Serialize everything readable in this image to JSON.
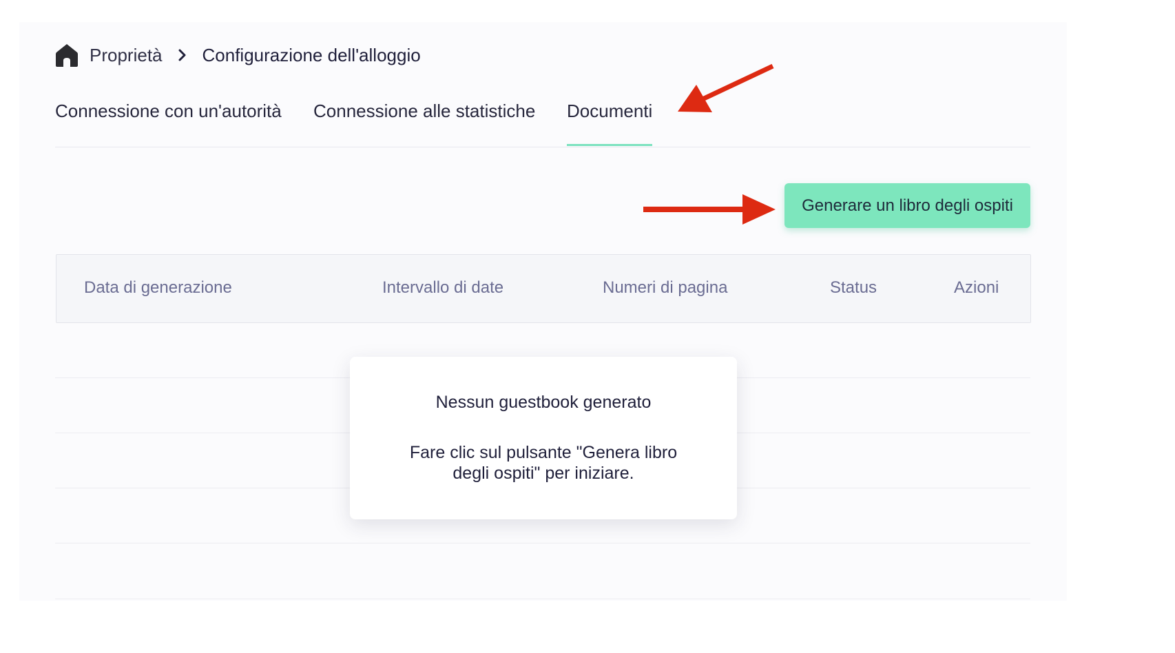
{
  "breadcrumb": {
    "home_icon": "home-icon",
    "root": "Proprietà",
    "separator_icon": "chevron-right-icon",
    "current": "Configurazione dell'alloggio"
  },
  "tabs": [
    {
      "label": "Connessione con un'autorità",
      "active": false
    },
    {
      "label": "Connessione alle statistiche",
      "active": false
    },
    {
      "label": "Documenti",
      "active": true
    }
  ],
  "actions": {
    "generate_label": "Generare un libro degli ospiti"
  },
  "table": {
    "columns": [
      "Data di generazione",
      "Intervallo di date",
      "Numeri di pagina",
      "Status",
      "Azioni"
    ],
    "rows": []
  },
  "empty_state": {
    "title": "Nessun guestbook generato",
    "description": "Fare clic sul pulsante \"Genera libro degli ospiti\" per iniziare."
  },
  "colors": {
    "accent": "#7de6bd",
    "tab_underline": "#7be2bf",
    "annotation_arrow": "#dd2a12"
  }
}
